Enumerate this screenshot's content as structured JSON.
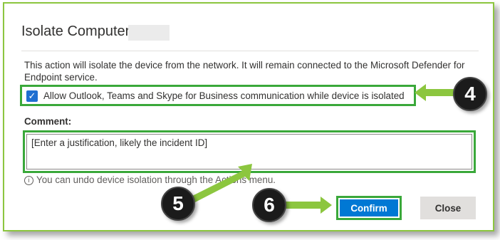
{
  "dialog": {
    "title": "Isolate Computer",
    "description": "This action will isolate the device from the network. It will remain connected to the Microsoft Defender for Endpoint service.",
    "checkbox_label": "Allow Outlook, Teams and Skype for Business communication while device is isolated",
    "checkbox_checked": true,
    "comment_label": "Comment:",
    "comment_value": "[Enter a justification, likely the incident ID]",
    "info_text": "You can undo device isolation through the Actions menu.",
    "confirm_label": "Confirm",
    "close_label": "Close"
  },
  "callouts": {
    "step_checkbox": "4",
    "step_comment": "5",
    "step_confirm": "6"
  },
  "colors": {
    "highlight_border": "#3aa83a",
    "arrow": "#8cc63f",
    "primary_button": "#0078d4",
    "checkbox": "#1f6fd1"
  },
  "icons": {
    "checkbox": "checkmark-icon",
    "info": "info-icon"
  }
}
